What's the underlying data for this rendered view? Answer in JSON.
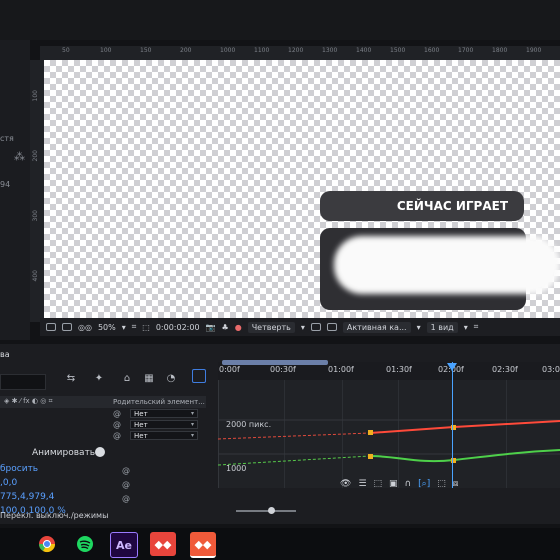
{
  "ruler": {
    "marks": [
      "50",
      "100",
      "150",
      "200",
      "1000",
      "1100",
      "1200",
      "1300",
      "1400",
      "1500",
      "1600",
      "1700",
      "1800",
      "1900"
    ]
  },
  "vruler": {
    "marks": [
      "100",
      "200",
      "300",
      "400"
    ]
  },
  "left_edge": {
    "text1": "стя",
    "text2": "94"
  },
  "overlay": {
    "now_playing": "СЕЙЧАС ИГРАЕТ"
  },
  "viewer": {
    "zoom": "50%",
    "timecode": "0:00:02:00",
    "resolution": "Четверть",
    "camera": "Активная ка...",
    "views": "1 вид",
    "icons": [
      "render-icon",
      "display-icon",
      "mask-icon",
      "crop-icon",
      "snapshot-icon",
      "color-wheel-icon",
      "grid-icon",
      "channel-icon"
    ]
  },
  "timeline": {
    "tab": "ва",
    "parent_header": "Родительский элемент...",
    "layers": [
      {
        "parent": "Нет"
      },
      {
        "parent": "Нет"
      },
      {
        "parent": "Нет"
      }
    ],
    "animate": "Анимировать:",
    "props": [
      "бросить",
      ",0,0",
      "775,4,979,4",
      "100,0,100,0 %"
    ],
    "time_labels": [
      "0:00f",
      "00:30f",
      "01:00f",
      "01:30f",
      "02:00f",
      "02:30f",
      "03:00"
    ],
    "graph_label_top": "2000 пикс.",
    "graph_label_bottom": "1000",
    "status": "Перекл. выключ./режимы",
    "accent": "#4aa3ff"
  },
  "taskbar": {
    "apps": [
      {
        "name": "chrome-app",
        "label": ""
      },
      {
        "name": "spotify-app",
        "label": ""
      },
      {
        "name": "after-effects-app",
        "label": "Ae"
      },
      {
        "name": "anydesk-app",
        "label": ""
      },
      {
        "name": "anydesk-app-active",
        "label": ""
      }
    ]
  }
}
